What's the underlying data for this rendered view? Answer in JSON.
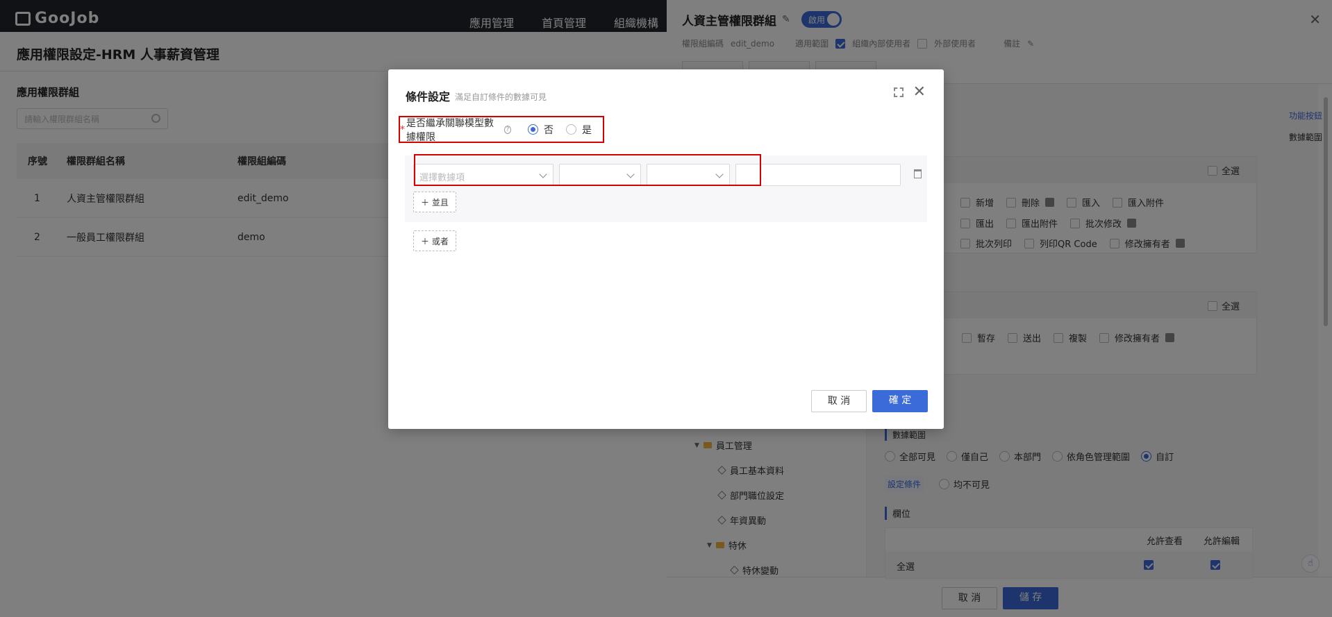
{
  "topbar": {
    "logo": "GooJob",
    "nav": [
      "應用管理",
      "首頁管理",
      "組織機構"
    ]
  },
  "page": {
    "title": "應用權限設定-HRM 人事薪資管理",
    "group_title": "應用權限群組",
    "search_placeholder": "請輸入權限群組名稱",
    "table": {
      "headers": [
        "序號",
        "權限群組名稱",
        "權限組編碼"
      ],
      "rows": [
        {
          "no": "1",
          "name": "人資主管權限群組",
          "code": "edit_demo"
        },
        {
          "no": "2",
          "name": "一般員工權限群組",
          "code": "demo"
        }
      ]
    }
  },
  "drawer": {
    "title": "人資主管權限群組",
    "toggle": "啟用",
    "meta": {
      "code_label": "權限組編碼",
      "code": "edit_demo",
      "scope_label": "適用範圍",
      "internal": "組織內部使用者",
      "external": "外部使用者",
      "remark": "備註"
    },
    "anchor": {
      "func": "功能按鈕",
      "data": "數據範圍"
    },
    "card1": {
      "select_all": "全選",
      "row1": [
        "新增",
        "刪除",
        "匯入",
        "匯入附件"
      ],
      "row2": [
        "匯出",
        "匯出附件",
        "批次修改"
      ],
      "row3": [
        "批次列印",
        "列印QR Code",
        "修改擁有者"
      ]
    },
    "card2": {
      "select_all": "全選",
      "row1": [
        "暫存",
        "送出",
        "複製",
        "修改擁有者"
      ]
    },
    "tree": {
      "folder1": "員工管理",
      "items1": [
        "員工基本資料",
        "部門職位設定",
        "年資異動"
      ],
      "folder2": "特休",
      "items2": [
        "特休變動"
      ]
    },
    "scope": {
      "title": "數據範圍",
      "options": [
        "全部可見",
        "僅自己",
        "本部門",
        "依角色管理範圍",
        "自訂"
      ],
      "selected": "自訂",
      "cond_link": "設定條件",
      "none": "均不可見"
    },
    "fields": {
      "title": "欄位",
      "col_view": "允許查看",
      "col_edit": "允許編輯",
      "row_label": "全選"
    },
    "footer": {
      "cancel": "取 消",
      "save": "儲 存"
    }
  },
  "modal": {
    "title": "條件設定",
    "subtitle": "滿足自訂條件的數據可見",
    "inherit_label": "是否繼承關聯模型數據權限",
    "opt_no": "否",
    "opt_yes": "是",
    "selected": "否",
    "select_placeholder": "選擇數據項",
    "and_btn": "並且",
    "or_btn": "或者",
    "cancel": "取 消",
    "confirm": "確 定"
  },
  "colors": {
    "accent": "#3a6bd8",
    "highlight": "#d60000",
    "topbar": "#20242d"
  }
}
